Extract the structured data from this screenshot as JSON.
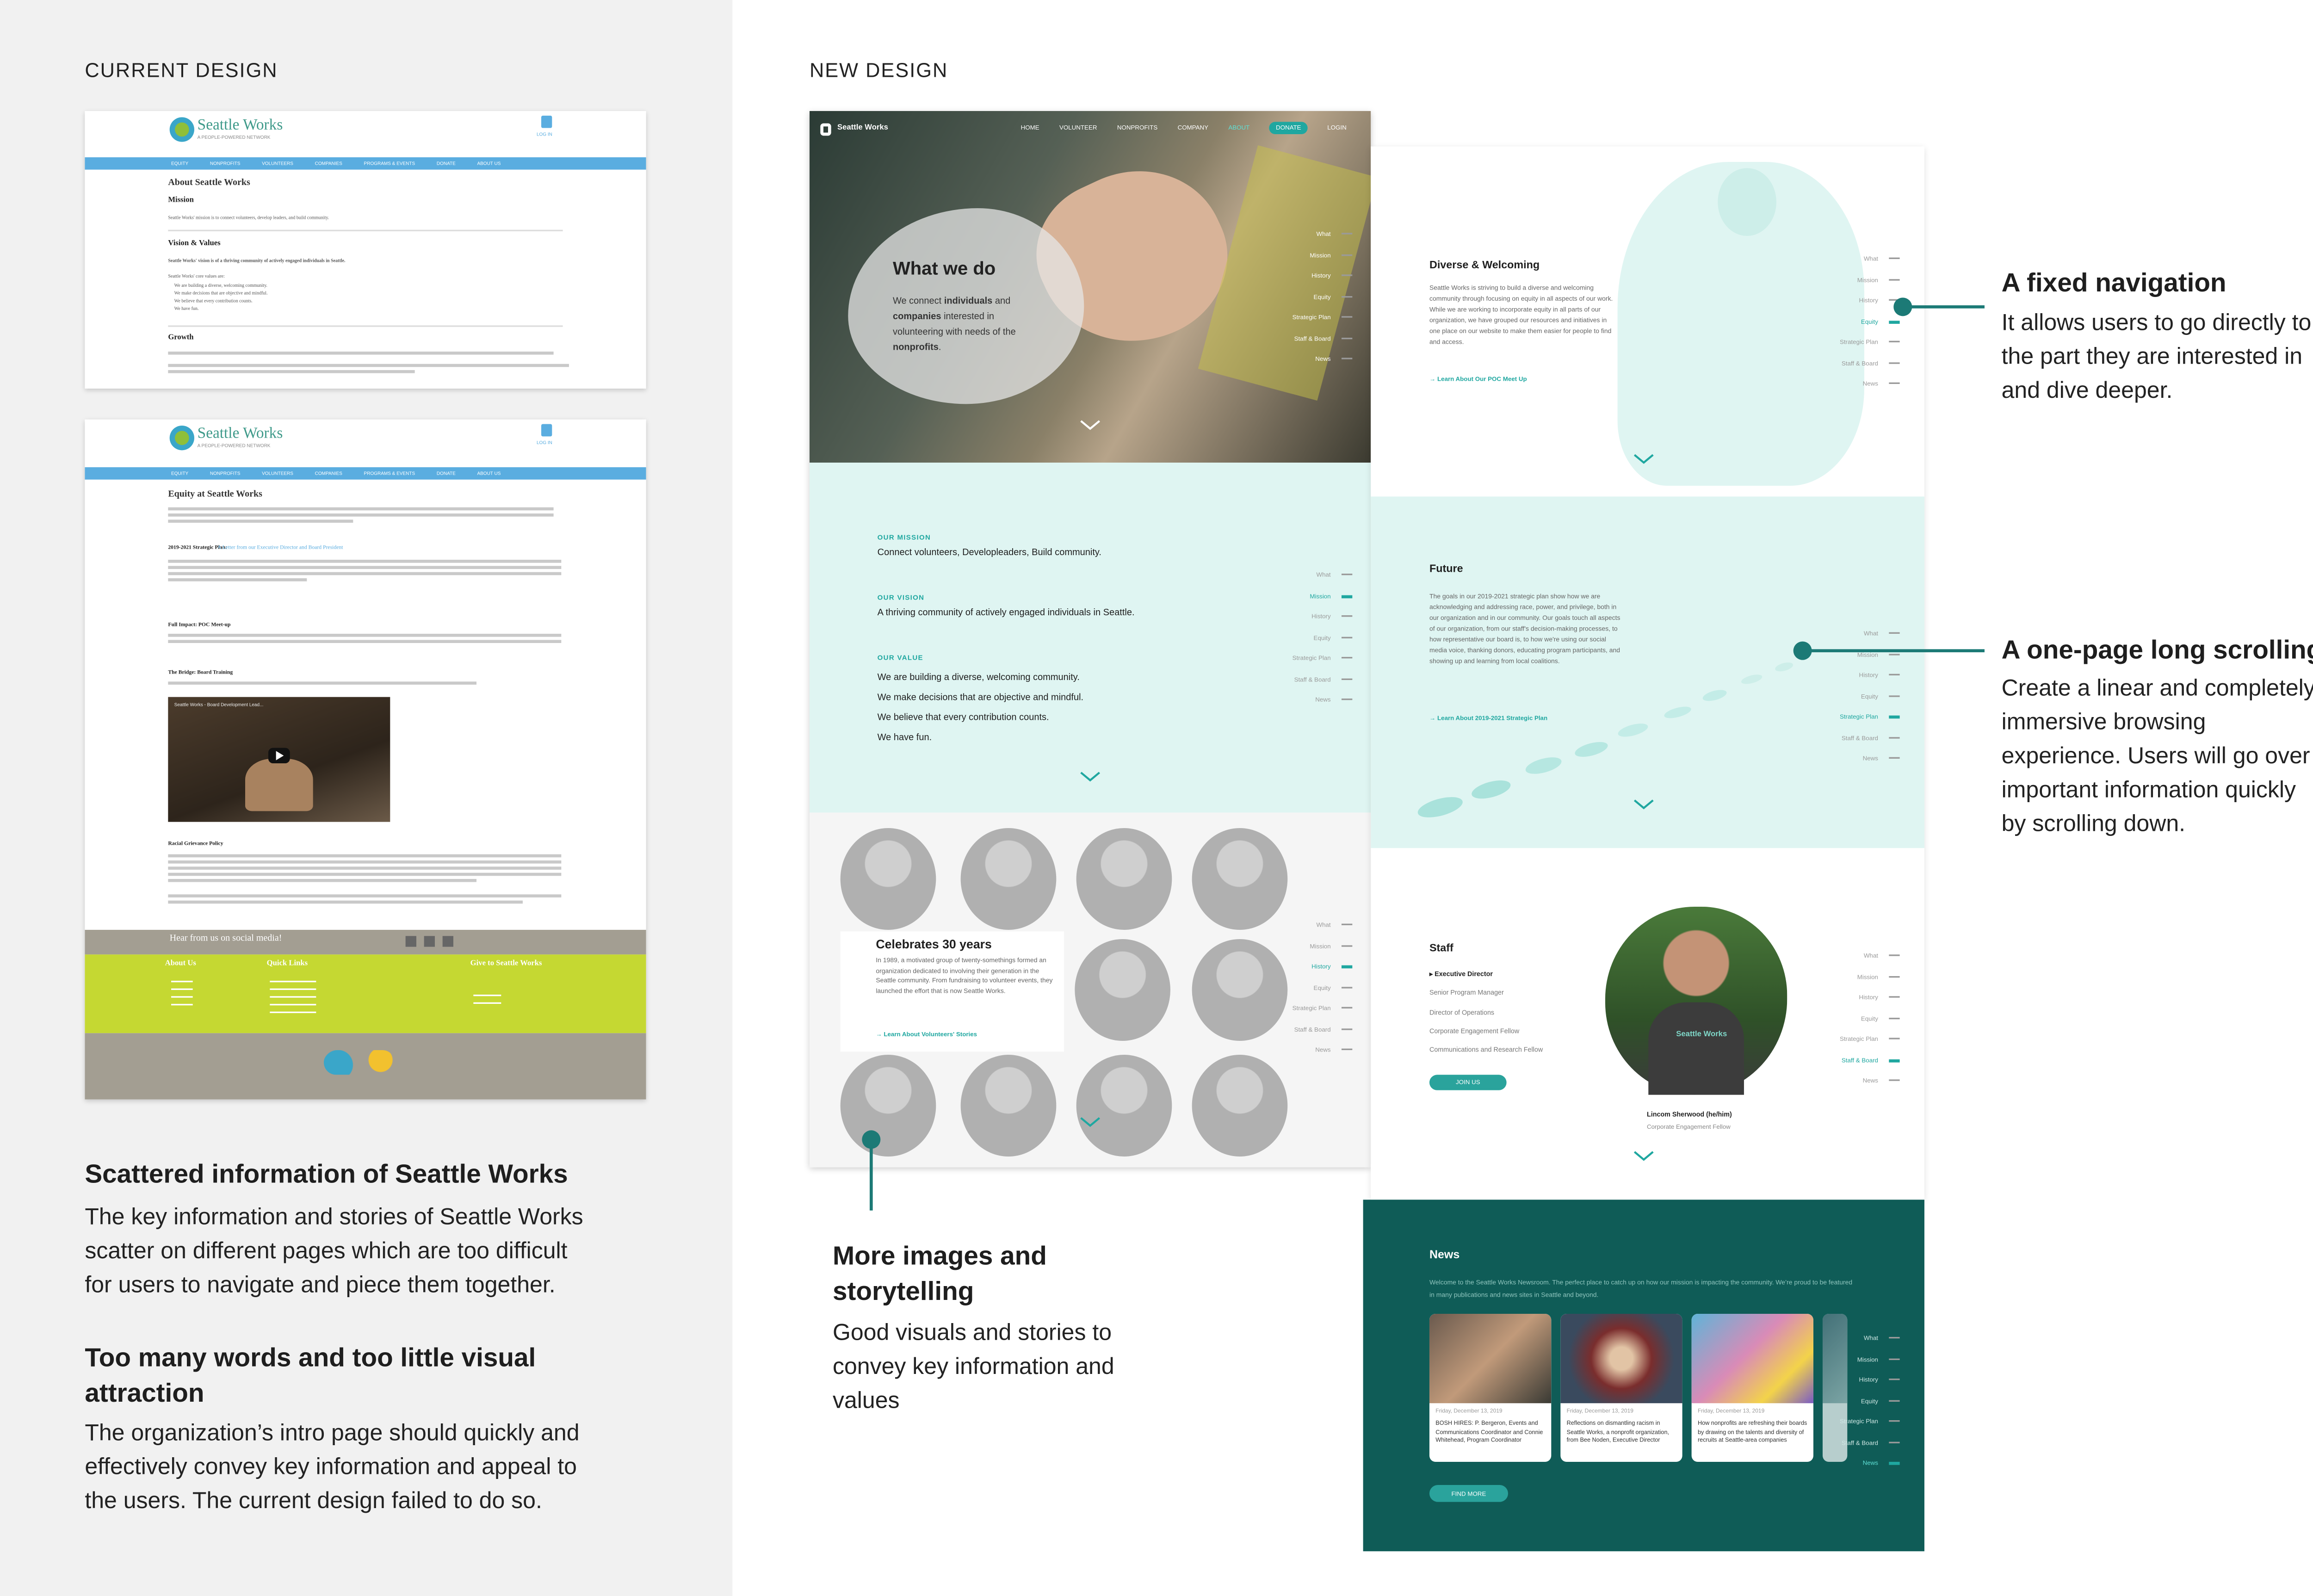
{
  "colors": {
    "accent": "#1fa7a0",
    "dark_teal": "#0f5c57",
    "mint": "#dff5f2",
    "old_nav": "#5aade0",
    "old_footer_green": "#c5d832",
    "old_footer_gray": "#a39e92",
    "left_bg": "#f1f1f1"
  },
  "current": {
    "heading": "CURRENT DESIGN",
    "logo": "Seattle Works",
    "logo_sub": "A PEOPLE-POWERED NETWORK",
    "login": "LOG IN",
    "nav": [
      "EQUITY",
      "NONPROFITS",
      "VOLUNTEERS",
      "COMPANIES",
      "PROGRAMS & EVENTS",
      "DONATE",
      "ABOUT US"
    ],
    "page1": {
      "title": "About Seattle Works",
      "mission_h": "Mission",
      "mission": "Seattle Works' mission is to connect volunteers, develop leaders, and build community.",
      "vision_h": "Vision & Values",
      "vision": "Seattle Works' vision is of a thriving community of actively engaged individuals in Seattle.",
      "values_intro": "Seattle Works' core values are:",
      "values": [
        "We are building a diverse, welcoming community.",
        "We make decisions that are objective and mindful.",
        "We believe that every contribution counts.",
        "We have fun."
      ],
      "growth_h": "Growth"
    },
    "page2": {
      "title": "Equity at Seattle Works",
      "plan_h": "2019-2021 Strategic Plan:",
      "plan_link": "A Letter from our Executive Director and Board President",
      "poc_h": "Full Impact: POC Meet-up",
      "bridge_h": "The Bridge: Board Training",
      "video_title": "Seattle Works - Board Development Lead...",
      "racial_h": "Racial Grievance Policy",
      "social": "Hear from us on social media!",
      "footer_cols": [
        "About Us",
        "Quick Links",
        "Give to Seattle Works"
      ]
    },
    "problems": [
      {
        "title": "Scattered information of Seattle Works",
        "body": [
          "The key information and stories of Seattle Works",
          "scatter on different pages which are too difficult",
          "for users to navigate and piece them together."
        ]
      },
      {
        "title": [
          "Too many words and too little visual",
          "attraction"
        ],
        "body": [
          "The organization’s intro page should quickly and",
          "effectively convey key information and appeal to",
          "the users. The current design failed to do so."
        ]
      }
    ]
  },
  "new": {
    "heading": "NEW DESIGN",
    "logo": "Seattle Works",
    "nav": [
      "HOME",
      "VOLUNTEER",
      "NONPROFITS",
      "COMPANY",
      "ABOUT",
      "DONATE",
      "LOGIN"
    ],
    "hero": {
      "title": "What we do",
      "text_parts": [
        "We connect ",
        "individuals",
        " and ",
        "companies",
        " interested in volunteering with needs of the ",
        "nonprofits",
        "."
      ]
    },
    "rail": [
      "What",
      "Mission",
      "History",
      "Equity",
      "Strategic Plan",
      "Staff & Board",
      "News"
    ],
    "mission": {
      "h1": "OUR MISSION",
      "t1": "Connect volunteers, Developleaders, Build community.",
      "h2": "OUR VISION",
      "t2": "A thriving community of actively engaged individuals in Seattle.",
      "h3": "OUR VALUE",
      "values": [
        "We are building a diverse, welcoming community.",
        "We make decisions that are objective and mindful.",
        "We believe that every contribution counts.",
        "We have fun."
      ]
    },
    "history": {
      "title": "Celebrates 30 years",
      "text": "In 1989, a motivated group of twenty-somethings formed an organization dedicated to involving their generation in the Seattle community. From fundraising to volunteer events, they launched the effort that is now Seattle Works.",
      "link": "→ Learn About Volunteers' Stories"
    },
    "equity": {
      "title": "Diverse & Welcoming",
      "text": "Seattle Works is striving to build a diverse and welcoming community through focusing on equity in all aspects of our work. While we are working to incorporate equity in all parts of our organization, we have grouped our resources and initiatives in one place on our website to make them easier for people to find and access.",
      "link": "→ Learn About Our POC Meet Up"
    },
    "future": {
      "title": "Future",
      "text": "The goals in our 2019-2021 strategic plan show how we are acknowledging and addressing race, power, and privilege, both in our organization and in our community. Our goals touch all aspects of our organization, from our staff's decision-making processes, to how representative our board is, to how we're using our social media voice, thanking donors, educating program participants, and showing up and learning from local coalitions.",
      "link": "→ Learn About 2019-2021 Strategic Plan"
    },
    "staff": {
      "title": "Staff",
      "roles": [
        "Executive Director",
        "Senior Program Manager",
        "Director of Operations",
        "Corporate Engagement Fellow",
        "Communications and Research Fellow"
      ],
      "join": "JOIN US",
      "name": "Lincom Sherwood (he/him)",
      "role": "Corporate Engagement Fellow",
      "shirt": "Seattle Works"
    },
    "news": {
      "title": "News",
      "intro": "Welcome to the Seattle Works Newsroom. The perfect place to catch up on how our mission is impacting the community. We’re proud to be featured in many publications and news sites in Seattle and beyond.",
      "cards": [
        {
          "date": "Friday, December 13, 2019",
          "text": "BOSH HIRES: P. Bergeron, Events and Communications Coordinator and Connie Whitehead, Program Coordinator"
        },
        {
          "date": "Friday, December 13, 2019",
          "text": "Reflections on dismantling racism in Seattle Works, a nonprofit organization, from Bee Noden, Executive Director"
        },
        {
          "date": "Friday, December 13, 2019",
          "text": "How nonprofits are refreshing their boards by drawing on the talents and diversity of recruits at Seattle-area companies"
        }
      ],
      "button": "FIND MORE"
    },
    "rail_active": {
      "equity": "Equity",
      "mission": "Mission",
      "history": "History",
      "future": "Strategic Plan",
      "staff": "Staff & Board",
      "news": "News"
    }
  },
  "callouts": [
    {
      "title": "A fixed navigation",
      "body": [
        "It allows users to go directly to",
        "the part they are interested in",
        "and dive deeper."
      ]
    },
    {
      "title": "A one-page long scrolling",
      "body": [
        "Create a linear and completely",
        "immersive browsing",
        "experience. Users will go over",
        "important information quickly",
        "by scrolling down."
      ]
    },
    {
      "title": [
        "More images and",
        "storytelling"
      ],
      "body": [
        "Good visuals and stories to",
        "convey key information and",
        "values"
      ]
    }
  ]
}
